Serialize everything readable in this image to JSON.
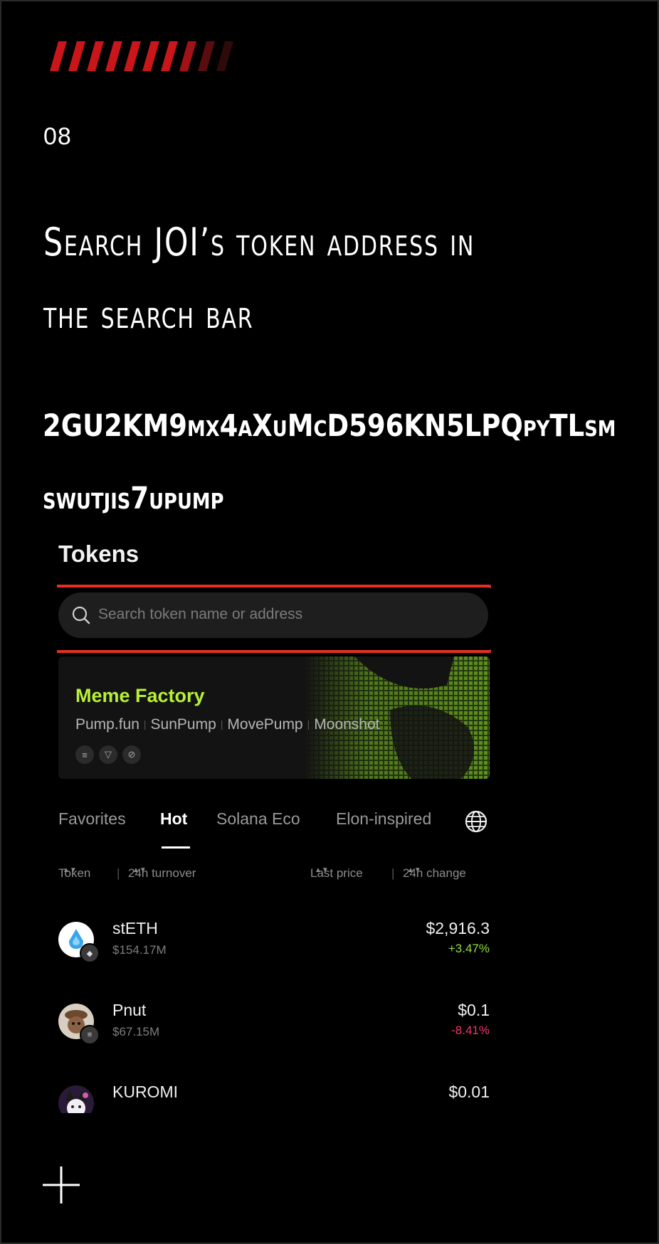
{
  "step": {
    "number": "08"
  },
  "heading": {
    "line1": "Search JOI’s token address in",
    "line2": "the search bar"
  },
  "address": {
    "line1": "2GU2KM9mx4aXuMcD596KN5LPQpyTLsm",
    "line2": "swutjis7upump"
  },
  "colors": {
    "accent_red": "#e8301f",
    "stripe_red": "#c8161b",
    "meme_green": "#b8f036",
    "up_green": "#8fe03a",
    "down_pink": "#f2336b"
  },
  "app": {
    "title": "Tokens",
    "search": {
      "placeholder": "Search token name or address",
      "icon": "search-icon"
    },
    "banner": {
      "title": "Meme Factory",
      "platforms": [
        "Pump.fun",
        "SunPump",
        "MovePump",
        "Moonshot"
      ],
      "chain_icons": [
        "solana-icon",
        "tron-icon",
        "move-icon"
      ]
    },
    "tabs": [
      {
        "label": "Favorites",
        "active": false
      },
      {
        "label": "Hot",
        "active": true
      },
      {
        "label": "Solana Eco",
        "active": false
      },
      {
        "label": "Elon-inspired",
        "active": false
      }
    ],
    "globe_icon": "globe-icon",
    "columns": {
      "token": "Token",
      "turnover": "24h turnover",
      "price": "Last price",
      "change": "24h change"
    },
    "rows": [
      {
        "symbol": "stETH",
        "turnover": "$154.17M",
        "price": "$2,916.3",
        "change": "+3.47%",
        "direction": "up"
      },
      {
        "symbol": "Pnut",
        "turnover": "$67.15M",
        "price": "$0.1",
        "change": "-8.41%",
        "direction": "down"
      },
      {
        "symbol": "KUROMI",
        "turnover": "",
        "price": "$0.01",
        "change": "",
        "direction": "up"
      }
    ]
  },
  "footer": {
    "icon": "plus-icon"
  }
}
